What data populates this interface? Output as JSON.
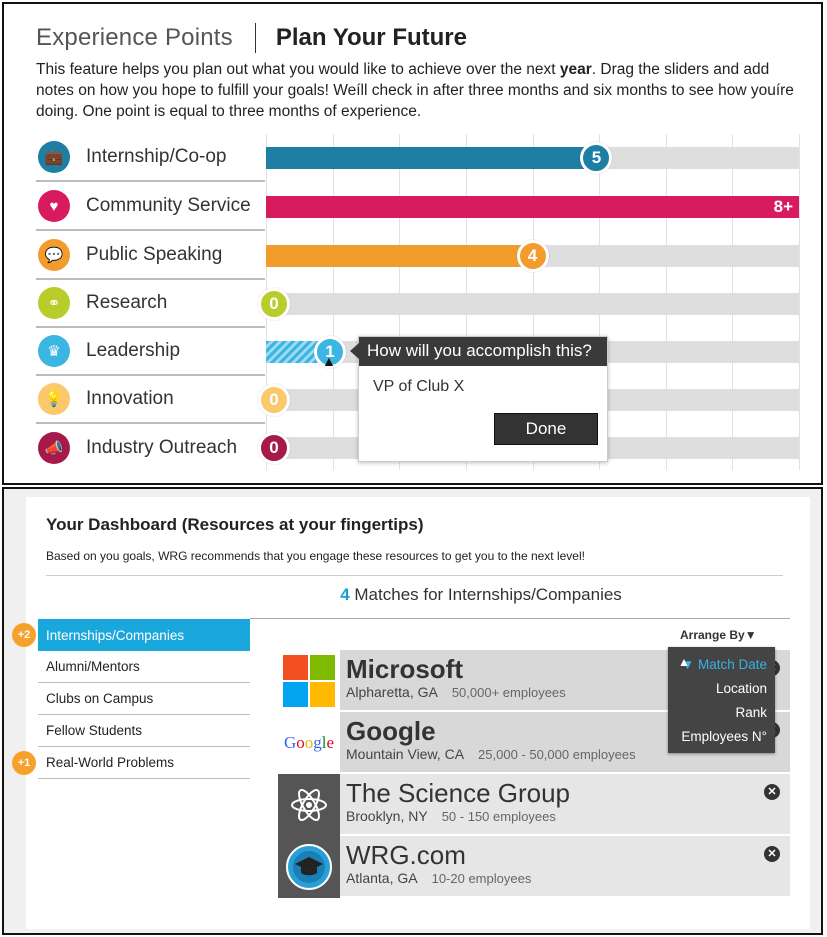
{
  "top": {
    "title_left": "Experience Points",
    "title_right": "Plan Your Future",
    "intro_prefix": "This feature helps you plan out what you would like to achieve over the next ",
    "intro_bold": "year",
    "intro_suffix": ". Drag the sliders and add notes on how you hope to fulfill your goals! Weíll check in after three months and six months to see how youíre doing. One point is equal to three months of experience.",
    "rows": [
      {
        "label": "Internship/Co-op",
        "value": "5",
        "fill_fraction": 0.62,
        "color": "#1e7ea3",
        "icon": "briefcase-icon",
        "glyph": "💼"
      },
      {
        "label": "Community Service",
        "value": "8+",
        "fill_fraction": 1.0,
        "color": "#d81b5e",
        "icon": "heart-icon",
        "glyph": "♥"
      },
      {
        "label": "Public Speaking",
        "value": "4",
        "fill_fraction": 0.5,
        "color": "#f39c2e",
        "icon": "speech-bubble-icon",
        "glyph": "💬"
      },
      {
        "label": "Research",
        "value": "0",
        "fill_fraction": 0.0,
        "color": "#b8cc2a",
        "icon": "glasses-icon",
        "glyph": "⚭"
      },
      {
        "label": "Leadership",
        "value": "1",
        "fill_fraction": 0.12,
        "color": "#3bb6e2",
        "icon": "crown-icon",
        "glyph": "♛"
      },
      {
        "label": "Innovation",
        "value": "0",
        "fill_fraction": 0.0,
        "color": "#fbc86b",
        "icon": "lightbulb-icon",
        "glyph": "💡"
      },
      {
        "label": "Industry Outreach",
        "value": "0",
        "fill_fraction": 0.0,
        "color": "#a51a4a",
        "icon": "megaphone-icon",
        "glyph": "📣"
      }
    ],
    "popup": {
      "question": "How will you accomplish this?",
      "note": "VP of Club X",
      "done_label": "Done"
    }
  },
  "dashboard": {
    "title": "Your Dashboard (Resources at your fingertips)",
    "description": "Based on you goals, WRG recommends that you engage these resources to get you to the next level!",
    "matches_count": "4",
    "matches_label": " Matches for Internships/Companies",
    "sidebar": [
      {
        "label": "Internships/Companies",
        "badge": "+2",
        "active": true
      },
      {
        "label": "Alumni/Mentors",
        "badge": "",
        "active": false
      },
      {
        "label": "Clubs on Campus",
        "badge": "",
        "active": false
      },
      {
        "label": "Fellow Students",
        "badge": "",
        "active": false
      },
      {
        "label": "Real-World Problems",
        "badge": "+1",
        "active": false
      }
    ],
    "arrange_label": "Arrange By",
    "arrange_options": [
      "Match Date",
      "Location",
      "Rank",
      "Employees N°"
    ],
    "companies": [
      {
        "name": "Microsoft",
        "location": "Alpharetta, GA",
        "employees": "50,000+ employees",
        "bold": true,
        "logo": "microsoft-logo"
      },
      {
        "name": "Google",
        "location": "Mountain View, CA",
        "employees": "25,000 - 50,000 employees",
        "bold": true,
        "logo": "google-logo",
        "logo_text": "Google"
      },
      {
        "name": "The Science Group",
        "location": "Brooklyn, NY",
        "employees": "50 - 150 employees",
        "bold": false,
        "logo": "atom-logo"
      },
      {
        "name": "WRG.com",
        "location": "Atlanta, GA",
        "employees": "10-20 employees",
        "bold": false,
        "logo": "graduation-cap-logo"
      }
    ]
  }
}
